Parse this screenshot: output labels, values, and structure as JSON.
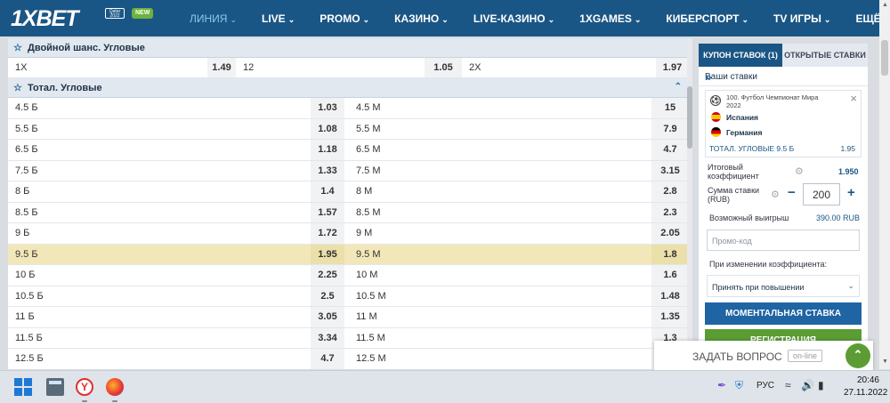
{
  "header": {
    "logo": "1XBET",
    "badge_qatar": "Qatar 2022",
    "badge_new": "NEW",
    "menu": [
      {
        "label": "ЛИНИЯ",
        "active": true,
        "dropdown": true
      },
      {
        "label": "LIVE",
        "dropdown": true
      },
      {
        "label": "PROMO",
        "dropdown": true
      },
      {
        "label": "КАЗИНО",
        "dropdown": true
      },
      {
        "label": "LIVE-КАЗИНО",
        "dropdown": true
      },
      {
        "label": "1XGAMES",
        "dropdown": true
      },
      {
        "label": "КИБЕРСПОРТ",
        "dropdown": true
      },
      {
        "label": "TV ИГРЫ",
        "dropdown": true
      },
      {
        "label": "ЕЩЁ",
        "dropdown": true
      }
    ]
  },
  "double_chance": {
    "title": "Двойной шанс. Угловые",
    "cells": [
      {
        "label": "1X",
        "odd": "1.49"
      },
      {
        "label": "12",
        "odd": "1.05"
      },
      {
        "label": "2X",
        "odd": "1.97"
      }
    ]
  },
  "total_corners": {
    "title": "Тотал. Угловые",
    "rows": [
      {
        "over": "4.5 Б",
        "over_odd": "1.03",
        "under": "4.5 М",
        "under_odd": "15"
      },
      {
        "over": "5.5 Б",
        "over_odd": "1.08",
        "under": "5.5 М",
        "under_odd": "7.9"
      },
      {
        "over": "6.5 Б",
        "over_odd": "1.18",
        "under": "6.5 М",
        "under_odd": "4.7"
      },
      {
        "over": "7.5 Б",
        "over_odd": "1.33",
        "under": "7.5 М",
        "under_odd": "3.15"
      },
      {
        "over": "8 Б",
        "over_odd": "1.4",
        "under": "8 М",
        "under_odd": "2.8"
      },
      {
        "over": "8.5 Б",
        "over_odd": "1.57",
        "under": "8.5 М",
        "under_odd": "2.3"
      },
      {
        "over": "9 Б",
        "over_odd": "1.72",
        "under": "9 М",
        "under_odd": "2.05"
      },
      {
        "over": "9.5 Б",
        "over_odd": "1.95",
        "under": "9.5 М",
        "under_odd": "1.8",
        "selected": true
      },
      {
        "over": "10 Б",
        "over_odd": "2.25",
        "under": "10 М",
        "under_odd": "1.6"
      },
      {
        "over": "10.5 Б",
        "over_odd": "2.5",
        "under": "10.5 М",
        "under_odd": "1.48"
      },
      {
        "over": "11 Б",
        "over_odd": "3.05",
        "under": "11 М",
        "under_odd": "1.35"
      },
      {
        "over": "11.5 Б",
        "over_odd": "3.34",
        "under": "11.5 М",
        "under_odd": "1.3"
      },
      {
        "over": "12.5 Б",
        "over_odd": "4.7",
        "under": "12.5 М",
        "under_odd": ""
      }
    ]
  },
  "coupon": {
    "tab_active": "КУПОН СТАВОК (1)",
    "tab_other": "ОТКРЫТЫЕ СТАВКИ",
    "your_bets": "Ваши ставки",
    "bet": {
      "event": "100. Футбол Чемпионат Мира 2022",
      "team1": "Испания",
      "team2": "Германия",
      "selection": "ТОТАЛ. УГЛОВЫЕ 9.5 Б",
      "odd": "1.95"
    },
    "total_coef_label": "Итоговый коэффициент",
    "total_coef": "1.950",
    "stake_label": "Сумма ставки (RUB)",
    "stake_value": "200",
    "possible_win_label": "Возможный выигрыш",
    "possible_win": "390.00 RUB",
    "promo_placeholder": "Промо-код",
    "odds_change_label": "При изменении коэффициента:",
    "odds_change_value": "Принять при повышении",
    "instant_bet": "МОМЕНТАЛЬНАЯ СТАВКА",
    "register": "РЕГИСТРАЦИЯ"
  },
  "ask_widget": {
    "text": "ЗАДАТЬ ВОПРОС",
    "status": "on-line"
  },
  "taskbar": {
    "lang": "РУС",
    "time": "20:46",
    "date": "27.11.2022"
  },
  "colors": {
    "header": "#1a5685",
    "selected_row": "#f2e7b9",
    "instant_button": "#1f64a3",
    "register_button": "#5b9d34"
  }
}
